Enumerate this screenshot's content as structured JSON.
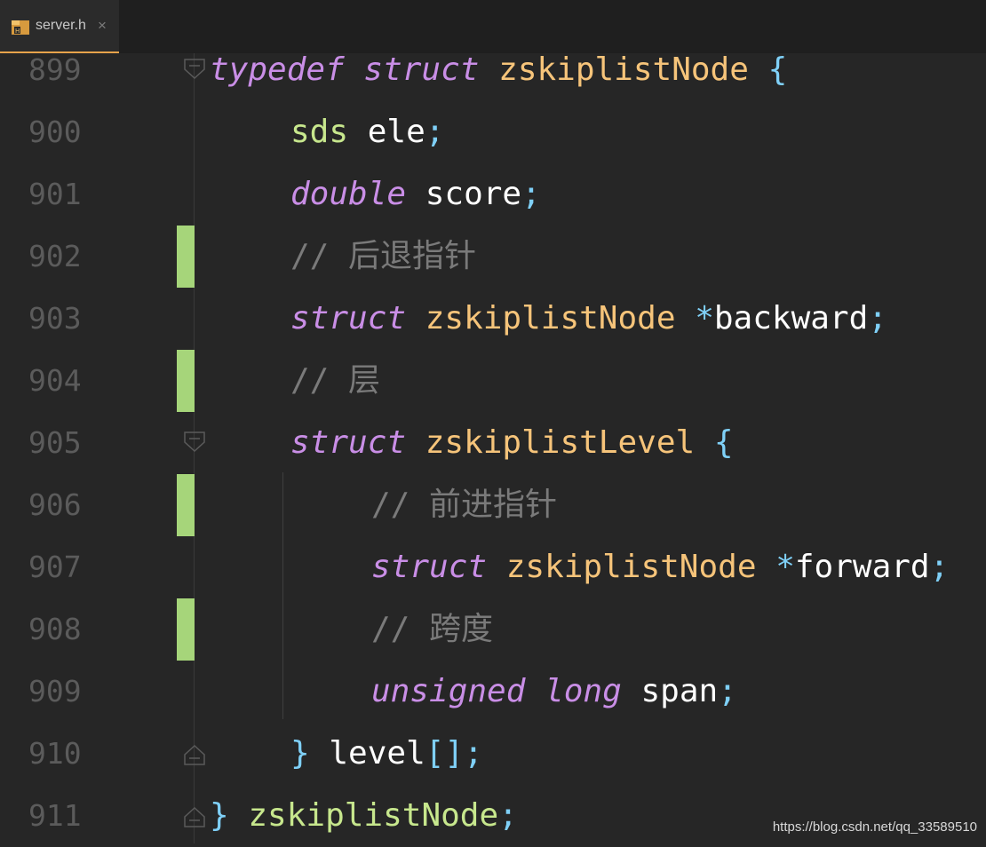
{
  "tab": {
    "label": "server.h",
    "close": "×",
    "icon": "header-file-icon",
    "accent": "#e7a34b"
  },
  "colors": {
    "background": "#262626",
    "line_number": "#5b5b5b",
    "keyword": "#c98ee6",
    "type_name": "#f6c47a",
    "builtin": "#c7e78d",
    "punctuation": "#7fd0f7",
    "identifier": "#ffffff",
    "comment": "#7a7a7a",
    "change_marker": "#a6d57a"
  },
  "lines": [
    {
      "num": "899",
      "tokens": [
        "typedef",
        " ",
        "struct",
        " ",
        "zskiplistNode",
        " ",
        "{"
      ]
    },
    {
      "num": "900",
      "tokens": [
        "sds",
        " ",
        "ele",
        ";"
      ]
    },
    {
      "num": "901",
      "tokens": [
        "double",
        " ",
        "score",
        ";"
      ]
    },
    {
      "num": "902",
      "tokens": [
        "// 后退指针"
      ]
    },
    {
      "num": "903",
      "tokens": [
        "struct",
        " ",
        "zskiplistNode",
        " ",
        "*",
        "backward",
        ";"
      ]
    },
    {
      "num": "904",
      "tokens": [
        "// 层"
      ]
    },
    {
      "num": "905",
      "tokens": [
        "struct",
        " ",
        "zskiplistLevel",
        " ",
        "{"
      ]
    },
    {
      "num": "906",
      "tokens": [
        "// 前进指针"
      ]
    },
    {
      "num": "907",
      "tokens": [
        "struct",
        " ",
        "zskiplistNode",
        " ",
        "*",
        "forward",
        ";"
      ]
    },
    {
      "num": "908",
      "tokens": [
        "// 跨度"
      ]
    },
    {
      "num": "909",
      "tokens": [
        "unsigned",
        " ",
        "long",
        " ",
        "span",
        ";"
      ]
    },
    {
      "num": "910",
      "tokens": [
        "}",
        " ",
        "level",
        "[]",
        ";"
      ]
    },
    {
      "num": "911",
      "tokens": [
        "}",
        " ",
        "zskiplistNode",
        ";"
      ]
    }
  ],
  "watermark": "https://blog.csdn.net/qq_33589510"
}
